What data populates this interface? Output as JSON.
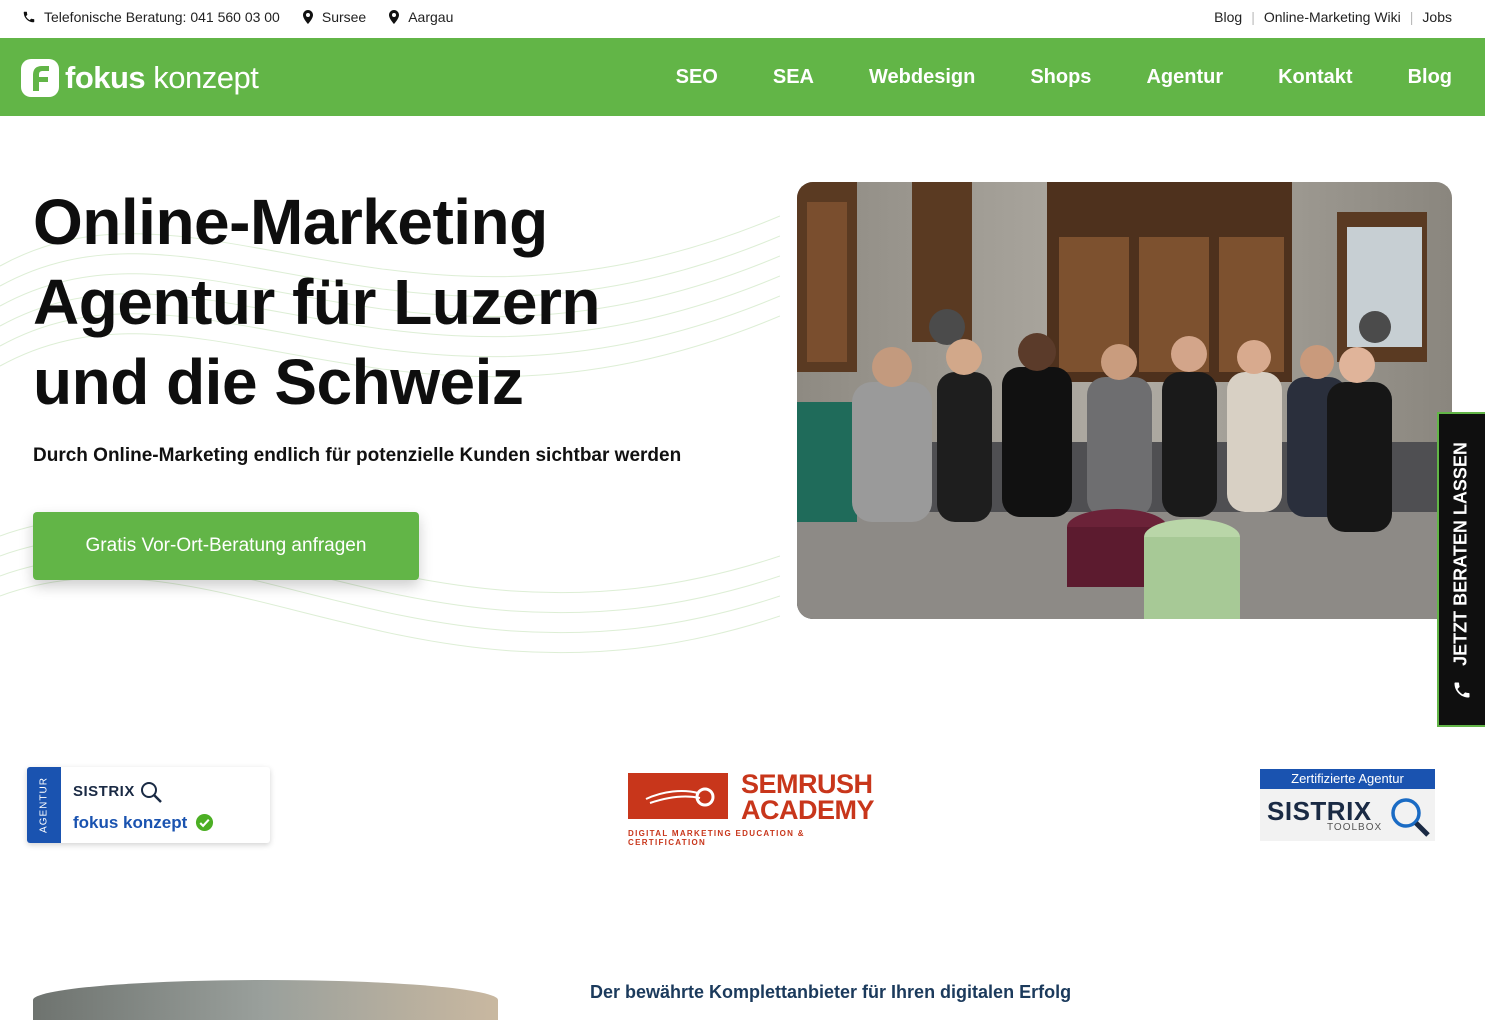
{
  "topbar": {
    "phone_label": "Telefonische Beratung: 041 560 03 00",
    "location1": "Sursee",
    "location2": "Aargau",
    "links": [
      "Blog",
      "Online-Marketing Wiki",
      "Jobs"
    ]
  },
  "brand": {
    "logo_bold": "fokus",
    "logo_light": " konzept"
  },
  "nav": {
    "items": [
      "SEO",
      "SEA",
      "Webdesign",
      "Shops",
      "Agentur",
      "Kontakt",
      "Blog"
    ]
  },
  "hero": {
    "headline_lines": [
      "Online-Marketing",
      "Agentur für Luzern",
      "und die Schweiz"
    ],
    "subline": "Durch Online-Marketing endlich für potenzielle Kunden sichtbar werden",
    "cta": "Gratis Vor-Ort-Beratung anfragen"
  },
  "sidetab": {
    "label": "JETZT BERATEN LASSEN"
  },
  "badges": {
    "sistrix_agentur": {
      "side": "AGENTUR",
      "brand": "SISTRIX",
      "name": "fokus konzept"
    },
    "semrush": {
      "line1": "SEMRUSH",
      "line2": "ACADEMY",
      "tagline": "DIGITAL MARKETING EDUCATION & CERTIFICATION"
    },
    "sistrix_cert": {
      "top": "Zertifizierte Agentur",
      "brand": "SISTRIX",
      "sub": "TOOLBOX"
    }
  },
  "next_section": {
    "heading_partial": "Der bewährte Komplettanbieter für Ihren digitalen Erfolg"
  },
  "colors": {
    "brand_green": "#62b547",
    "brand_blue": "#1a53b0",
    "semrush_red": "#c8361b"
  }
}
